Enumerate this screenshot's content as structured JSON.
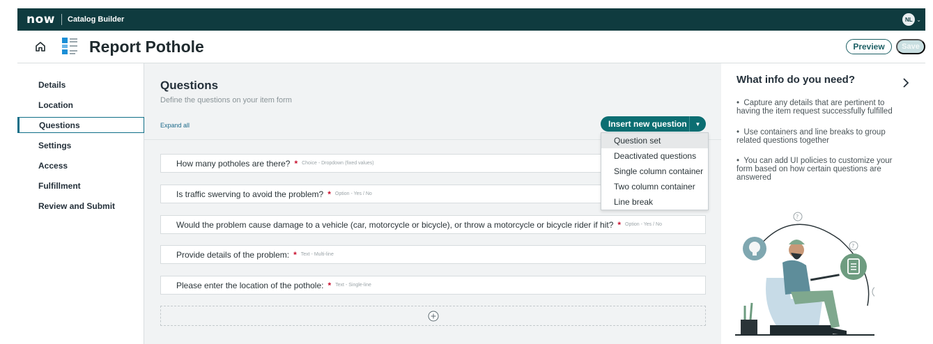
{
  "topbar": {
    "logo": "now",
    "app_name": "Catalog Builder",
    "user_initials": "NL"
  },
  "header": {
    "title": "Report Pothole",
    "preview_label": "Preview",
    "save_label": "Save"
  },
  "sidebar": {
    "items": [
      {
        "label": "Details",
        "active": false
      },
      {
        "label": "Location",
        "active": false
      },
      {
        "label": "Questions",
        "active": true
      },
      {
        "label": "Settings",
        "active": false
      },
      {
        "label": "Access",
        "active": false
      },
      {
        "label": "Fulfillment",
        "active": false
      },
      {
        "label": "Review and Submit",
        "active": false
      }
    ]
  },
  "main": {
    "title": "Questions",
    "subtitle": "Define the questions on your item form",
    "expand_all": "Expand all",
    "insert_button": "Insert new question",
    "dropdown": {
      "items": [
        "Question set",
        "Deactivated questions",
        "Single column container",
        "Two column container",
        "Line break"
      ],
      "highlighted": "Question set"
    },
    "questions": [
      {
        "text": "How many potholes are there?",
        "type": "Choice - Dropdown (fixed values)"
      },
      {
        "text": "Is traffic swerving to avoid the problem?",
        "type": "Option - Yes / No"
      },
      {
        "text": "Would the problem cause damage to a vehicle (car, motorcycle or bicycle), or throw a motorcycle or bicycle rider if hit?",
        "type": "Option - Yes / No"
      },
      {
        "text": "Provide details of the problem:",
        "type": "Text - Multi-line"
      },
      {
        "text": "Please enter the location of the pothole:",
        "type": "Text - Single-line"
      }
    ],
    "required_marker": "*"
  },
  "right_panel": {
    "title": "What info do you need?",
    "tips": [
      "Capture any details that are pertinent to having the item request successfully fulfilled",
      "Use containers and line breaks to group related questions together",
      "You can add UI policies to customize your form based on how certain questions are answered"
    ]
  },
  "colors": {
    "topbar": "#0f3b3f",
    "accent": "#0c6e72",
    "required": "#c8102e"
  }
}
